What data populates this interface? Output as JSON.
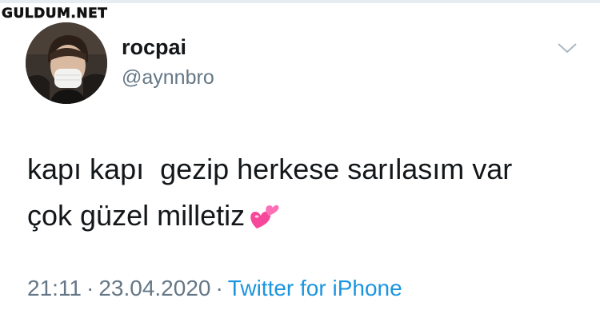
{
  "watermark": "GULDUM.NET",
  "user": {
    "name": "rocpai",
    "handle": "@aynnbro"
  },
  "tweet": {
    "line1": "kapı kapı  gezip herkese sarılasım var",
    "line2": "çok güzel milletiz",
    "emoji": "two-hearts-emoji"
  },
  "meta": {
    "time": "21:11",
    "separator": "·",
    "date": "23.04.2020",
    "source": "Twitter for iPhone"
  },
  "colors": {
    "text": "#14171a",
    "secondary": "#657786",
    "link": "#1b95e0",
    "heart": "#f7479a"
  }
}
